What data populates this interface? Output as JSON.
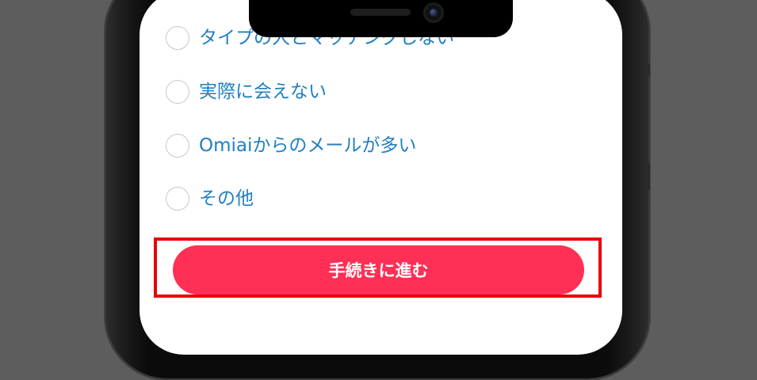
{
  "survey": {
    "options": [
      {
        "label": "タイプの人とマッチングしない"
      },
      {
        "label": "実際に会えない"
      },
      {
        "label": "Omiaiからのメールが多い"
      },
      {
        "label": "その他"
      }
    ]
  },
  "cta": {
    "label": "手続きに進む",
    "color": "#ff2f55",
    "highlight_color": "#e8000b"
  },
  "colors": {
    "option_text": "#1f7fc0",
    "background": "#5d5d5d"
  }
}
